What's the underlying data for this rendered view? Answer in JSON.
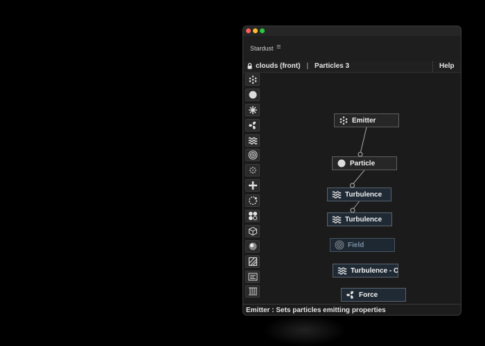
{
  "panel": {
    "tab_title": "Stardust",
    "menu_icon": "hamburger-menu-icon"
  },
  "composition": {
    "name": "clouds (front)",
    "separator": "|",
    "layer": "Particles 3",
    "help_label": "Help"
  },
  "toolbar": {
    "tools": [
      {
        "name": "emitter-tool",
        "icon": "emitter-dots-icon"
      },
      {
        "name": "particle-tool",
        "icon": "circle-icon"
      },
      {
        "name": "burst-tool",
        "icon": "burst-icon"
      },
      {
        "name": "force-tool",
        "icon": "fan-icon"
      },
      {
        "name": "turbulence-tool",
        "icon": "wave-icon"
      },
      {
        "name": "field-tool",
        "icon": "concentric-circles-icon"
      },
      {
        "name": "dots-tool",
        "icon": "dotted-flower-icon"
      },
      {
        "name": "plus-tool",
        "icon": "plus-icon"
      },
      {
        "name": "loop-tool",
        "icon": "dashed-circle-icon"
      },
      {
        "name": "grid-tool",
        "icon": "four-circles-icon"
      },
      {
        "name": "model-tool",
        "icon": "cube-icon"
      },
      {
        "name": "material-tool",
        "icon": "sphere-icon"
      },
      {
        "name": "mask-tool",
        "icon": "hatched-square-icon"
      },
      {
        "name": "panel-tool",
        "icon": "panel-icon"
      },
      {
        "name": "replicator-tool",
        "icon": "hanging-lines-icon"
      }
    ]
  },
  "graph": {
    "nodes": [
      {
        "label": "Emitter",
        "icon": "emitter-dots-icon"
      },
      {
        "label": "Particle",
        "icon": "circle-icon"
      },
      {
        "label": "Turbulence",
        "icon": "wave-icon"
      },
      {
        "label": "Turbulence",
        "icon": "wave-icon"
      },
      {
        "label": "Field",
        "icon": "concentric-circles-icon",
        "disabled": true
      },
      {
        "label": "Turbulence - O",
        "icon": "wave-icon"
      },
      {
        "label": "Force",
        "icon": "fan-icon"
      }
    ]
  },
  "status": {
    "text": "Emitter : Sets particles emitting properties"
  }
}
